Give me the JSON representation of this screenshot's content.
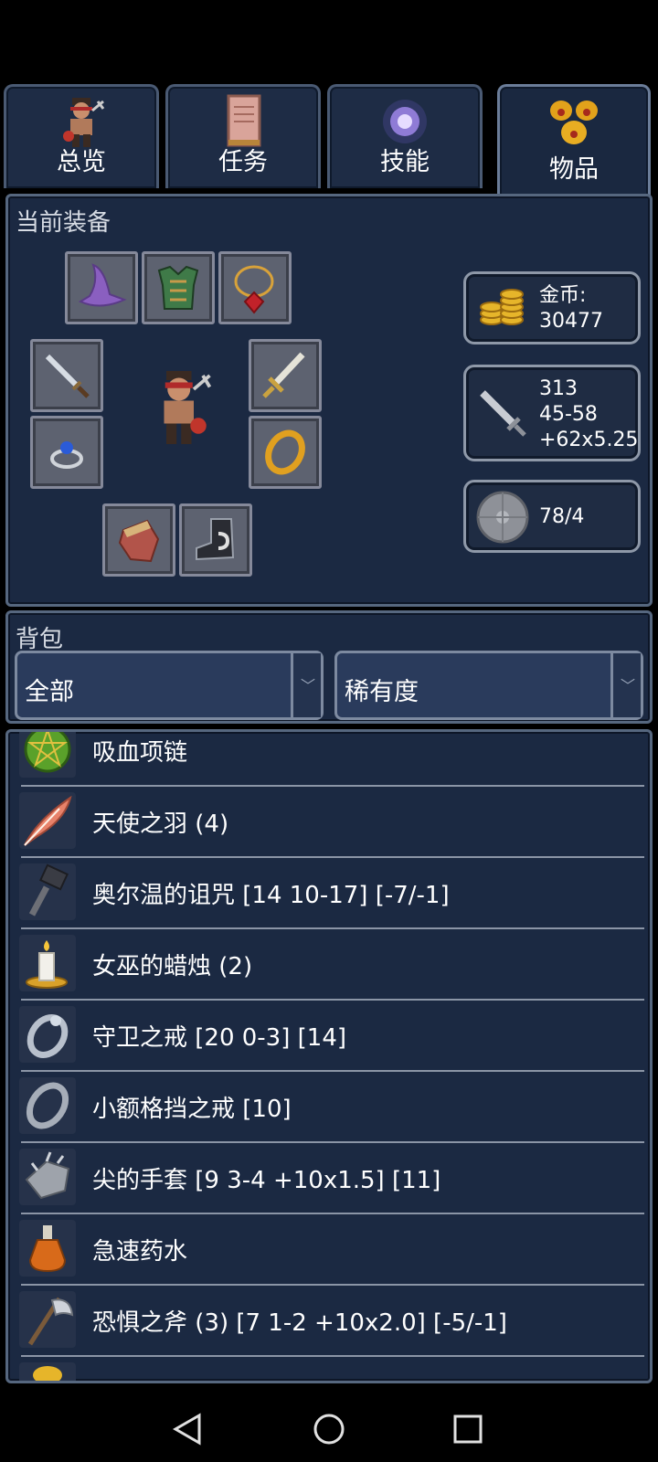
{
  "tabs": [
    {
      "label": "总览",
      "icon": "character-icon",
      "active": false
    },
    {
      "label": "任务",
      "icon": "scroll-book-icon",
      "active": false
    },
    {
      "label": "技能",
      "icon": "magic-orb-icon",
      "active": false
    },
    {
      "label": "物品",
      "icon": "gold-bags-icon",
      "active": true
    }
  ],
  "equipment": {
    "title": "当前装备",
    "slots": [
      "wizard-hat-icon",
      "leather-armor-icon",
      "amulet-icon",
      "dagger-icon",
      "sword-icon",
      "sapphire-ring-icon",
      "gold-ring-icon",
      "glove-icon",
      "boot-icon"
    ],
    "gold": {
      "label": "金币:",
      "value": "30477"
    },
    "attack": {
      "line1": "313",
      "line2": "45-58",
      "line3": "+62x5.25"
    },
    "defense": {
      "value": "78/4"
    }
  },
  "backpack": {
    "title": "背包",
    "filter": "全部",
    "sort": "稀有度",
    "items": [
      {
        "name": "吸血项链",
        "icon": "pentagram-necklace-icon"
      },
      {
        "name": "天使之羽 (4)",
        "icon": "feather-icon"
      },
      {
        "name": "奥尔温的诅咒 [14 10-17] [-7/-1]",
        "icon": "hammer-icon"
      },
      {
        "name": "女巫的蜡烛 (2)",
        "icon": "candle-icon"
      },
      {
        "name": "守卫之戒 [20 0-3] [14]",
        "icon": "silver-ring-icon"
      },
      {
        "name": "小额格挡之戒 [10]",
        "icon": "plain-ring-icon"
      },
      {
        "name": "尖的手套 [9 3-4 +10x1.5] [11]",
        "icon": "spiked-gauntlet-icon"
      },
      {
        "name": "急速药水",
        "icon": "potion-icon"
      },
      {
        "name": "恐惧之斧 (3) [7 1-2 +10x2.0] [-5/-1]",
        "icon": "axe-icon"
      }
    ]
  },
  "navbar": {
    "back": "back-icon",
    "home": "home-icon",
    "recents": "recents-icon"
  },
  "colors": {
    "panel_bg": "#1b2942",
    "border": "#56677f",
    "separator": "#8b95a6"
  }
}
